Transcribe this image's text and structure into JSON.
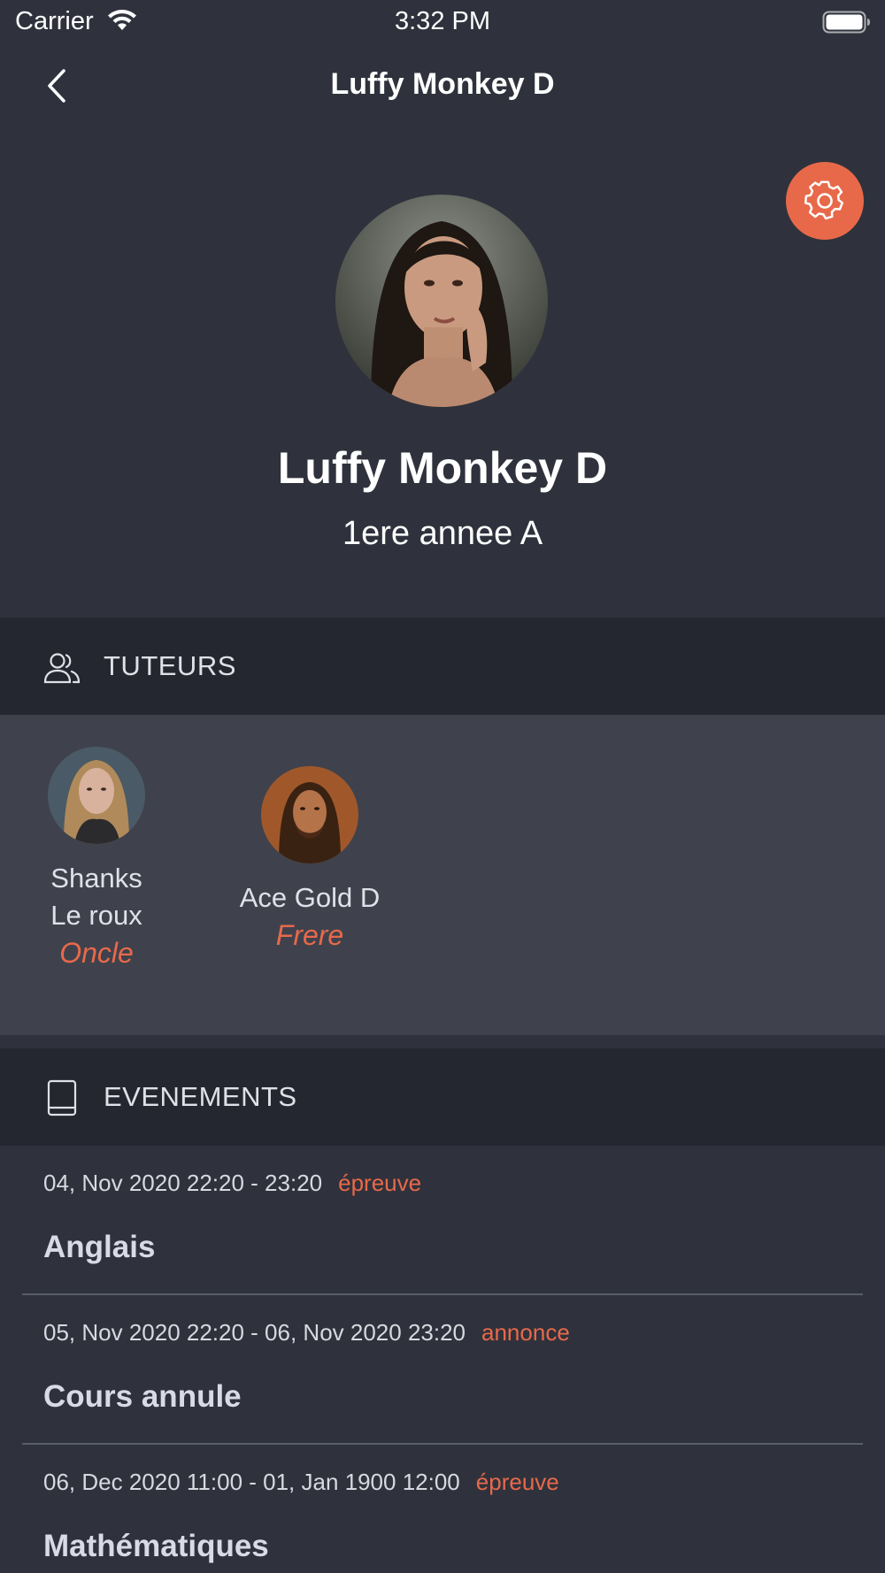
{
  "status_bar": {
    "carrier": "Carrier",
    "time": "3:32 PM"
  },
  "nav": {
    "title": "Luffy Monkey D"
  },
  "profile": {
    "name": "Luffy Monkey D",
    "class": "1ere annee A"
  },
  "tutors_section": {
    "label": "TUTEURS",
    "tutors": [
      {
        "name_line1": "Shanks",
        "name_line2": "Le roux",
        "relation": "Oncle"
      },
      {
        "name_line1": "Ace Gold D",
        "relation": "Frere"
      }
    ]
  },
  "events_section": {
    "label": "EVENEMENTS",
    "events": [
      {
        "date": "04, Nov 2020 22:20 - 23:20",
        "type": "épreuve",
        "title": "Anglais"
      },
      {
        "date": "05, Nov 2020 22:20 - 06, Nov 2020 23:20",
        "type": "annonce",
        "title": "Cours annule"
      },
      {
        "date": "06, Dec 2020 11:00 - 01, Jan 1900 12:00",
        "type": "épreuve",
        "title": "Mathématiques"
      }
    ]
  },
  "colors": {
    "accent": "#e8694a",
    "background": "#2f323c",
    "section_header": "#252730",
    "panel": "#3f424d"
  },
  "icons": {
    "back": "chevron-left-icon",
    "settings": "gear-icon",
    "tutors": "people-icon",
    "events": "book-icon"
  }
}
